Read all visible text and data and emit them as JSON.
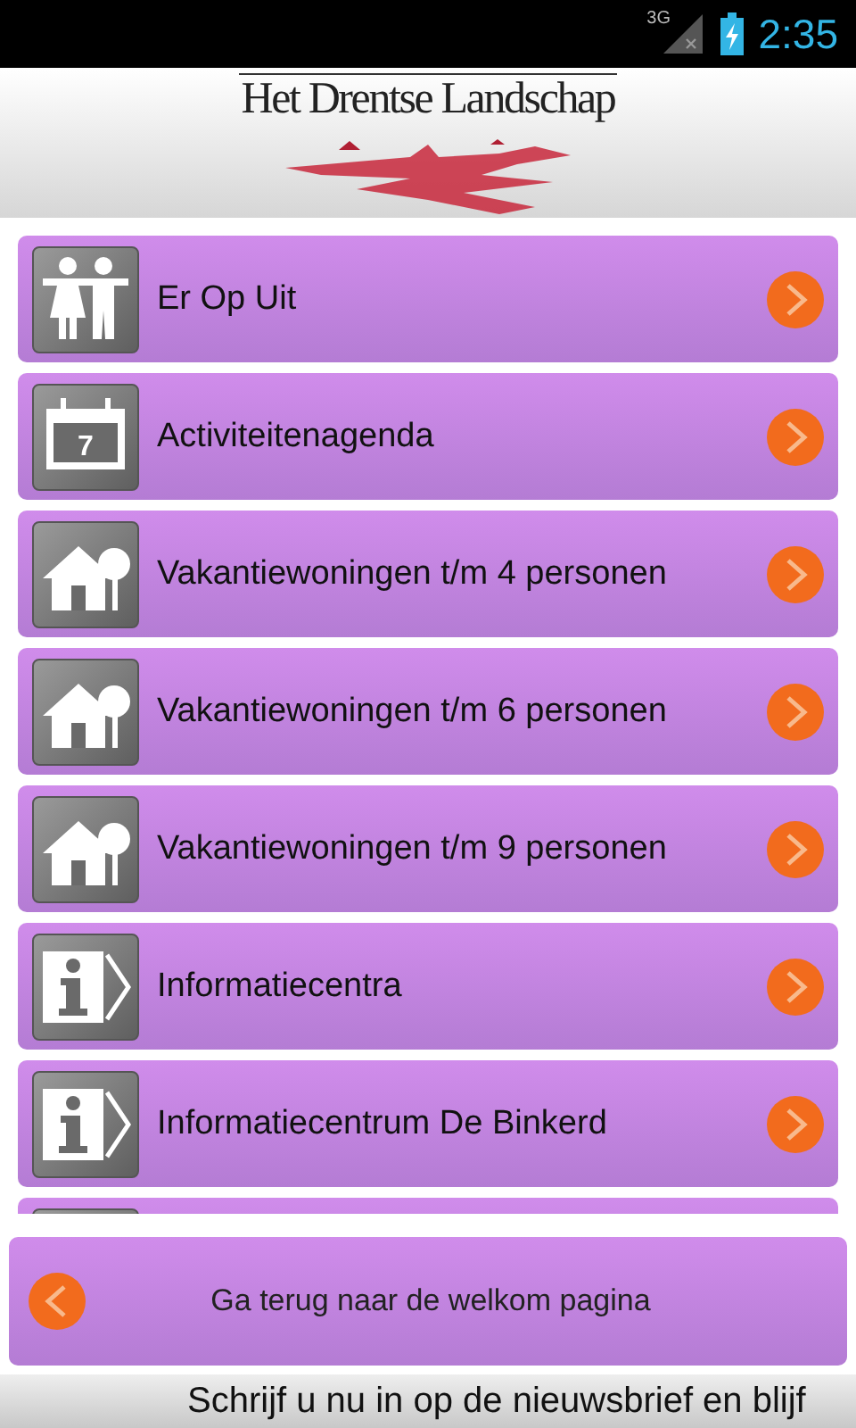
{
  "status_bar": {
    "network": "3G",
    "time": "2:35"
  },
  "header": {
    "title": "Het Drentse Landschap"
  },
  "menu": [
    {
      "kind": "people",
      "label": "Er Op Uit"
    },
    {
      "kind": "calendar",
      "icon_text": "7",
      "label": "Activiteitenagenda"
    },
    {
      "kind": "house",
      "label": "Vakantiewoningen t/m 4 personen"
    },
    {
      "kind": "house",
      "label": "Vakantiewoningen t/m 6 personen"
    },
    {
      "kind": "house",
      "label": "Vakantiewoningen t/m 9 personen"
    },
    {
      "kind": "info",
      "label": "Informatiecentra"
    },
    {
      "kind": "info",
      "label": "Informatiecentrum De Binkerd"
    },
    {
      "kind": "blank"
    }
  ],
  "back_button": {
    "label": "Ga terug naar de welkom pagina"
  },
  "ticker": "Schrijf u nu in op de nieuwsbrief en blijf"
}
